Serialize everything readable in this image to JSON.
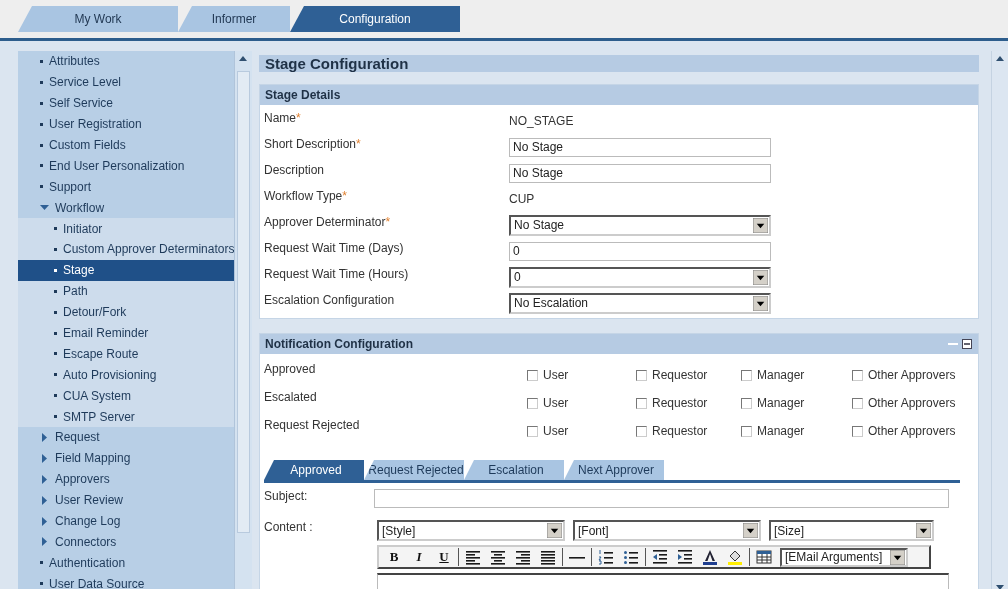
{
  "top_tabs": [
    {
      "label": "My Work",
      "selected": false
    },
    {
      "label": "Informer",
      "selected": false
    },
    {
      "label": "Configuration",
      "selected": true
    }
  ],
  "sidebar": {
    "items": [
      {
        "label": "Attributes",
        "kind": "leaf",
        "selected": false
      },
      {
        "label": "Service Level",
        "kind": "leaf",
        "selected": false
      },
      {
        "label": "Self Service",
        "kind": "leaf",
        "selected": false
      },
      {
        "label": "User Registration",
        "kind": "leaf",
        "selected": false
      },
      {
        "label": "Custom Fields",
        "kind": "leaf",
        "selected": false
      },
      {
        "label": "End User Personalization",
        "kind": "leaf",
        "selected": false
      },
      {
        "label": "Support",
        "kind": "leaf",
        "selected": false
      },
      {
        "label": "Workflow",
        "kind": "folder",
        "expanded": true,
        "selected": false,
        "children": [
          {
            "label": "Initiator",
            "kind": "leaf",
            "selected": false
          },
          {
            "label": "Custom Approver Determinators",
            "kind": "leaf",
            "selected": false
          },
          {
            "label": "Stage",
            "kind": "leaf",
            "selected": true
          },
          {
            "label": "Path",
            "kind": "leaf",
            "selected": false
          },
          {
            "label": "Detour/Fork",
            "kind": "leaf",
            "selected": false
          },
          {
            "label": "Email Reminder",
            "kind": "leaf",
            "selected": false
          },
          {
            "label": "Escape Route",
            "kind": "leaf",
            "selected": false
          },
          {
            "label": "Auto Provisioning",
            "kind": "leaf",
            "selected": false
          },
          {
            "label": "CUA System",
            "kind": "leaf",
            "selected": false
          },
          {
            "label": "SMTP Server",
            "kind": "leaf",
            "selected": false
          }
        ]
      },
      {
        "label": "Request",
        "kind": "folder",
        "expanded": false,
        "selected": false
      },
      {
        "label": "Field Mapping",
        "kind": "folder",
        "expanded": false,
        "selected": false
      },
      {
        "label": "Approvers",
        "kind": "folder",
        "expanded": false,
        "selected": false
      },
      {
        "label": "User Review",
        "kind": "folder",
        "expanded": false,
        "selected": false
      },
      {
        "label": "Change Log",
        "kind": "folder",
        "expanded": false,
        "selected": false
      },
      {
        "label": "Connectors",
        "kind": "folder",
        "expanded": false,
        "selected": false
      },
      {
        "label": "Authentication",
        "kind": "leaf",
        "selected": false
      },
      {
        "label": "User Data Source",
        "kind": "leaf",
        "selected": false
      }
    ]
  },
  "page_title": "Stage Configuration",
  "stage_details": {
    "title": "Stage Details",
    "fields": [
      {
        "label": "Name",
        "marker": "*",
        "kind": "text",
        "value": "NO_STAGE"
      },
      {
        "label": "Short Description",
        "marker": "*",
        "kind": "input",
        "value": "No Stage"
      },
      {
        "label": "Description",
        "kind": "input",
        "value": "No Stage"
      },
      {
        "label": "Workflow Type",
        "marker": "*",
        "kind": "text",
        "value": "CUP"
      },
      {
        "label": "Approver Determinator",
        "marker": "*",
        "kind": "select",
        "value": "No Stage"
      },
      {
        "label": "Request Wait Time (Days)",
        "kind": "input",
        "value": "0"
      },
      {
        "label": "Request Wait Time (Hours)",
        "kind": "select",
        "value": "0"
      },
      {
        "label": "Escalation Configuration",
        "kind": "select",
        "value": "No Escalation"
      }
    ]
  },
  "notification": {
    "title": "Notification Configuration",
    "rows": [
      {
        "label": "Approved",
        "options": [
          {
            "label": "User",
            "checked": false
          },
          {
            "label": "Requestor",
            "checked": false
          },
          {
            "label": "Manager",
            "checked": false
          },
          {
            "label": "Other Approvers",
            "checked": false
          }
        ]
      },
      {
        "label": "Escalated",
        "options": [
          {
            "label": "User",
            "checked": false
          },
          {
            "label": "Requestor",
            "checked": false
          },
          {
            "label": "Manager",
            "checked": false
          },
          {
            "label": "Other Approvers",
            "checked": false
          }
        ]
      },
      {
        "label": "Request Rejected",
        "options": [
          {
            "label": "User",
            "checked": false
          },
          {
            "label": "Requestor",
            "checked": false
          },
          {
            "label": "Manager",
            "checked": false
          },
          {
            "label": "Other Approvers",
            "checked": false
          }
        ]
      }
    ],
    "tabs": [
      {
        "label": "Approved",
        "selected": true
      },
      {
        "label": "Request Rejected",
        "selected": false
      },
      {
        "label": "Escalation",
        "selected": false
      },
      {
        "label": "Next Approver",
        "selected": false
      }
    ],
    "subject_label": "Subject:",
    "content_label": "Content :",
    "selects": [
      "[Style]",
      "[Font]",
      "[Size]"
    ],
    "toolbar": [
      {
        "kind": "bold",
        "label": "B"
      },
      {
        "kind": "italic",
        "label": "I"
      },
      {
        "kind": "underline",
        "label": "U"
      },
      {
        "kind": "sep"
      },
      {
        "kind": "align-left"
      },
      {
        "kind": "align-center"
      },
      {
        "kind": "align-right"
      },
      {
        "kind": "justify"
      },
      {
        "kind": "sep"
      },
      {
        "kind": "rule"
      },
      {
        "kind": "sep"
      },
      {
        "kind": "numbered-list"
      },
      {
        "kind": "bullet-list"
      },
      {
        "kind": "sep"
      },
      {
        "kind": "outdent"
      },
      {
        "kind": "indent"
      },
      {
        "kind": "font-color"
      },
      {
        "kind": "highlight"
      },
      {
        "kind": "sep"
      },
      {
        "kind": "table"
      },
      {
        "kind": "select",
        "label": "[EMail Arguments]"
      }
    ]
  }
}
